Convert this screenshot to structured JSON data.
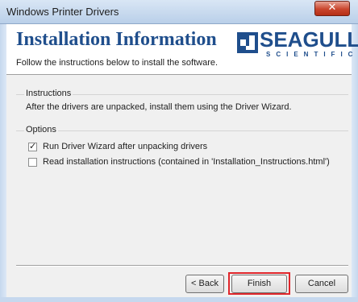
{
  "window": {
    "title": "Windows Printer Drivers",
    "close_glyph": "✕"
  },
  "header": {
    "title": "Installation Information",
    "subtitle": "Follow the instructions below to install the software.",
    "logo": {
      "word": "SEAGULL",
      "sub": "SCIENTIFIC"
    }
  },
  "instructions": {
    "group_title": "Instructions",
    "text": "After the drivers are unpacked, install them using the Driver Wizard."
  },
  "options": {
    "group_title": "Options",
    "items": [
      {
        "label": "Run Driver Wizard after unpacking drivers",
        "checked": true
      },
      {
        "label": "Read installation instructions (contained in 'Installation_Instructions.html')",
        "checked": false
      }
    ]
  },
  "buttons": {
    "back": "< Back",
    "finish": "Finish",
    "cancel": "Cancel"
  },
  "colors": {
    "brand": "#1f4e8c",
    "highlight": "#e0262b"
  }
}
